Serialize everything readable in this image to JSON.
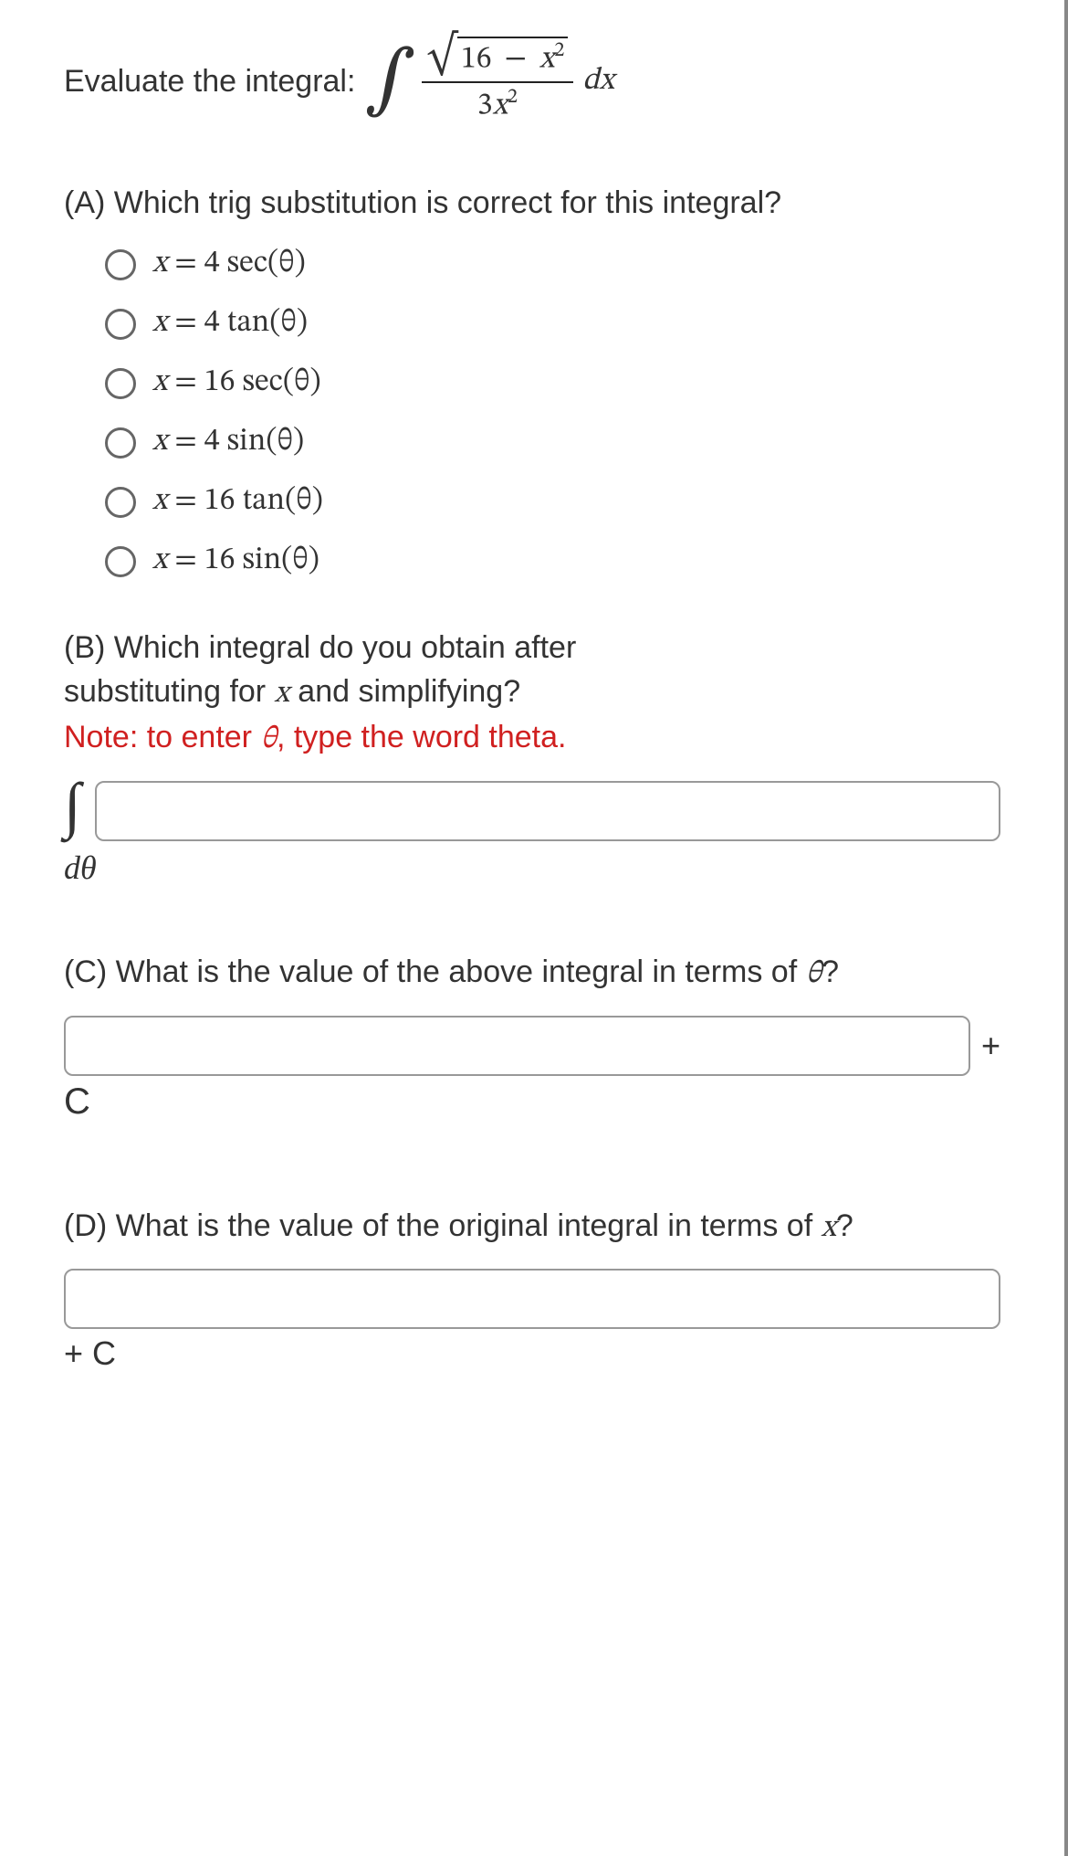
{
  "prompt": {
    "label": "Evaluate the integral:",
    "numerator_inside_sqrt_a": "16",
    "numerator_inside_sqrt_minus": "−",
    "numerator_inside_sqrt_b": "x",
    "numerator_inside_sqrt_b_exp": "2",
    "denominator_coeff": "3",
    "denominator_var": "x",
    "denominator_exp": "2",
    "dx": "dx"
  },
  "partA": {
    "question": "(A) Which trig substitution is correct for this integral?",
    "options": [
      {
        "lhs": "x",
        "eq": "=",
        "rhs_coeff": "4",
        "rhs_func": "sec",
        "rhs_arg": "(θ)"
      },
      {
        "lhs": "x",
        "eq": "=",
        "rhs_coeff": "4",
        "rhs_func": "tan",
        "rhs_arg": "(θ)"
      },
      {
        "lhs": "x",
        "eq": "=",
        "rhs_coeff": "16",
        "rhs_func": "sec",
        "rhs_arg": "(θ)"
      },
      {
        "lhs": "x",
        "eq": "=",
        "rhs_coeff": "4",
        "rhs_func": "sin",
        "rhs_arg": "(θ)"
      },
      {
        "lhs": "x",
        "eq": "=",
        "rhs_coeff": "16",
        "rhs_func": "tan",
        "rhs_arg": "(θ)"
      },
      {
        "lhs": "x",
        "eq": "=",
        "rhs_coeff": "16",
        "rhs_func": "sin",
        "rhs_arg": "(θ)"
      }
    ]
  },
  "partB": {
    "question_line1": "(B) Which integral do you obtain after",
    "question_line2_a": "substituting for ",
    "question_line2_var": "x",
    "question_line2_b": " and simplifying?",
    "note_a": "Note: to enter ",
    "note_theta": "θ",
    "note_b": ", type the word theta.",
    "dtheta": "dθ",
    "input_value": ""
  },
  "partC": {
    "question_a": "(C) What is the value of the above integral in terms of ",
    "question_var": "θ",
    "question_b": "?",
    "plus": "+",
    "C": "C",
    "input_value": ""
  },
  "partD": {
    "question_a": "(D) What is the value of the original integral in terms of ",
    "question_var": "x",
    "question_b": "?",
    "plus_c": "+ C",
    "input_value": ""
  }
}
